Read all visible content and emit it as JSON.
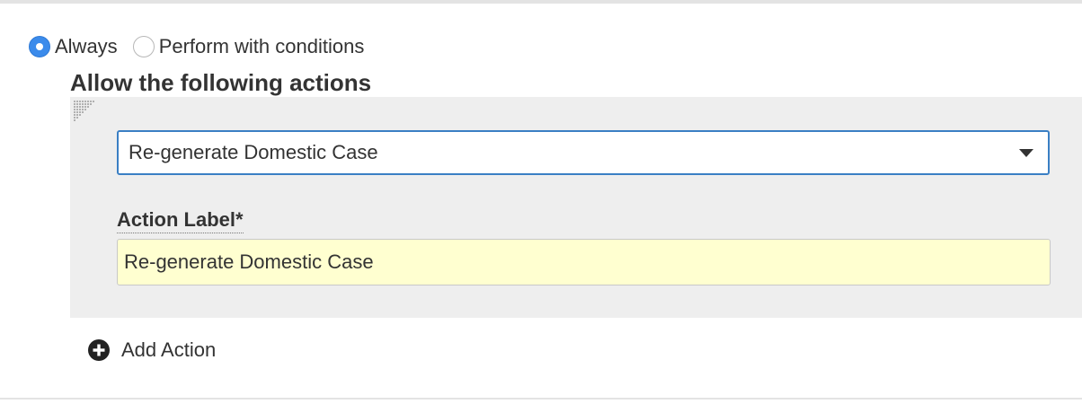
{
  "trigger_mode": {
    "options": [
      {
        "label": "Always",
        "selected": true
      },
      {
        "label": "Perform with conditions",
        "selected": false
      }
    ]
  },
  "actions_section": {
    "title": "Allow the following actions",
    "action": {
      "selected_action": "Re-generate Domestic Case",
      "label_field": {
        "label": "Action Label*",
        "value": "Re-generate Domestic Case"
      }
    },
    "add_action_label": "Add Action"
  },
  "icons": {
    "drag_handle": "drag-handle-icon",
    "dropdown": "chevron-down-icon",
    "add": "plus-circle-icon"
  },
  "colors": {
    "radio_selected": "#3b8beb",
    "select_border": "#3a7fc4",
    "input_background": "#ffffd0",
    "panel_background": "#eeeeee"
  }
}
